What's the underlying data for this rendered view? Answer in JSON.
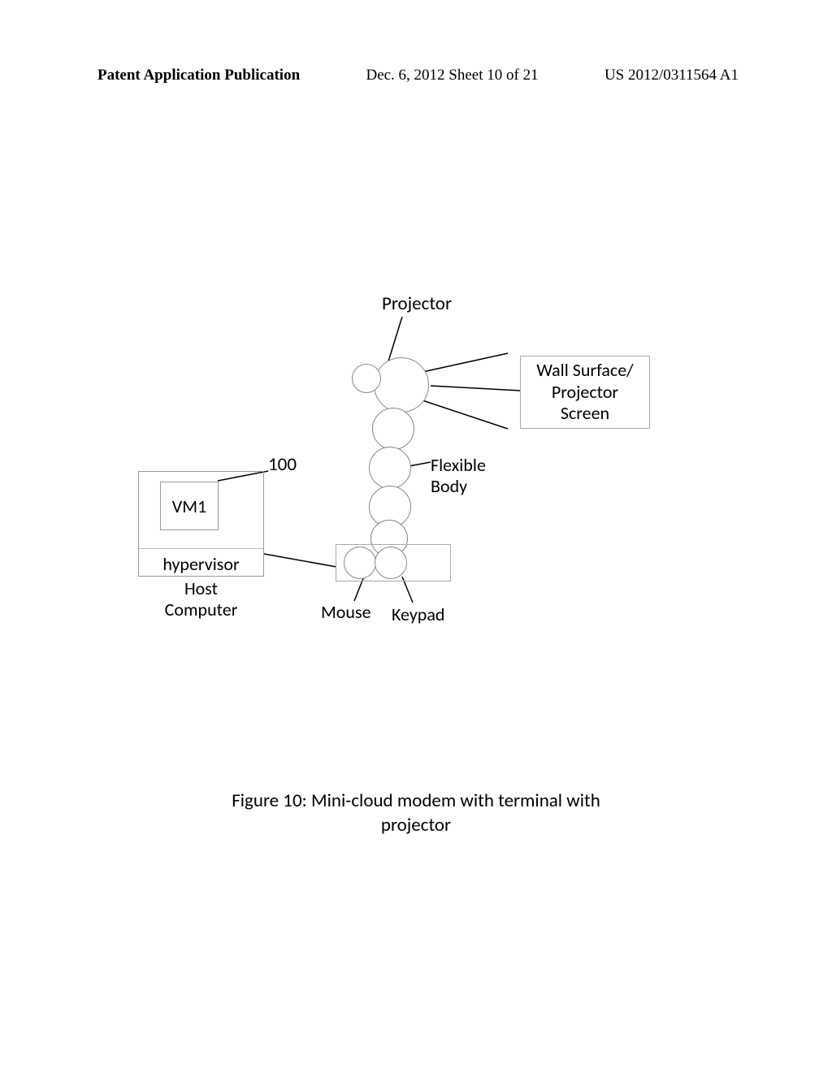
{
  "header": {
    "left": "Patent Application Publication",
    "center": "Dec. 6, 2012   Sheet 10 of 21",
    "right": "US 2012/0311564 A1"
  },
  "diagram": {
    "ref_number": "100",
    "vm_label": "VM1",
    "hypervisor_label": "hypervisor",
    "host_label_line1": "Host",
    "host_label_line2": "Computer",
    "projector_label": "Projector",
    "wall_label_line1": "Wall Surface/",
    "wall_label_line2": "Projector",
    "wall_label_line3": "Screen",
    "flexible_label_line1": "Flexible",
    "flexible_label_line2": "Body",
    "mouse_label": "Mouse",
    "keypad_label": "Keypad"
  },
  "caption": {
    "line1": "Figure 10: Mini-cloud modem with terminal with",
    "line2": "projector"
  }
}
